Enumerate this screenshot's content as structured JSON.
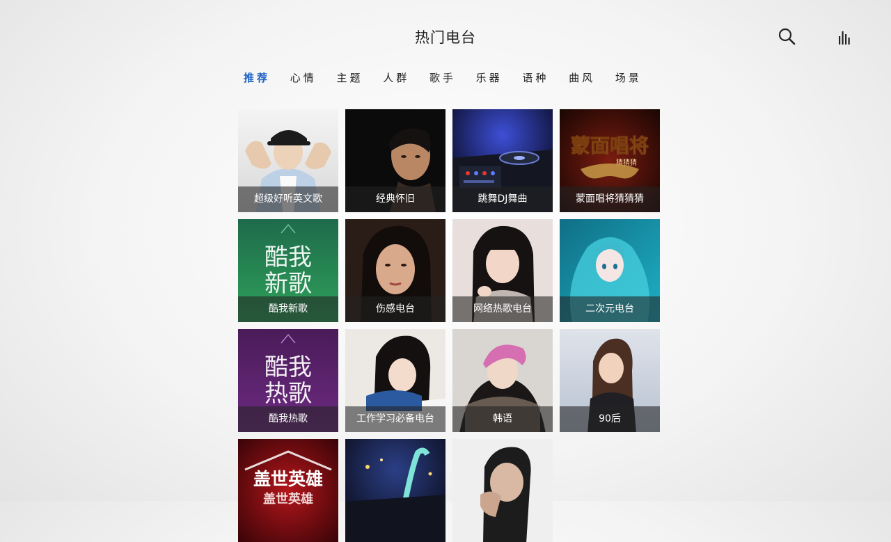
{
  "header": {
    "title": "热门电台",
    "search_icon": "search-icon",
    "equalizer_icon": "equalizer-icon"
  },
  "tabs": [
    {
      "label": "推荐",
      "active": true
    },
    {
      "label": "心情"
    },
    {
      "label": "主题"
    },
    {
      "label": "人群"
    },
    {
      "label": "歌手"
    },
    {
      "label": "乐器"
    },
    {
      "label": "语种"
    },
    {
      "label": "曲风"
    },
    {
      "label": "场景"
    }
  ],
  "stations": [
    {
      "label": "超级好听英文歌"
    },
    {
      "label": "经典怀旧"
    },
    {
      "label": "跳舞DJ舞曲"
    },
    {
      "label": "蒙面唱将猜猜猜",
      "art_text": "蒙面唱将",
      "art_subtext": "猜猜猜"
    },
    {
      "label": "酷我新歌",
      "art_text": [
        "酷我",
        "新歌"
      ]
    },
    {
      "label": "伤感电台"
    },
    {
      "label": "网络热歌电台"
    },
    {
      "label": "二次元电台"
    },
    {
      "label": "酷我热歌",
      "art_text": [
        "酷我",
        "热歌"
      ]
    },
    {
      "label": "工作学习必备电台"
    },
    {
      "label": "韩语"
    },
    {
      "label": "90后"
    },
    {
      "label": "",
      "art_text": "盖世英雄",
      "art_subtext": "盖世英雄"
    },
    {
      "label": ""
    },
    {
      "label": ""
    }
  ],
  "colors": {
    "accent": "#1f63c6",
    "caption_bg": "rgba(35,35,35,0.58)"
  }
}
